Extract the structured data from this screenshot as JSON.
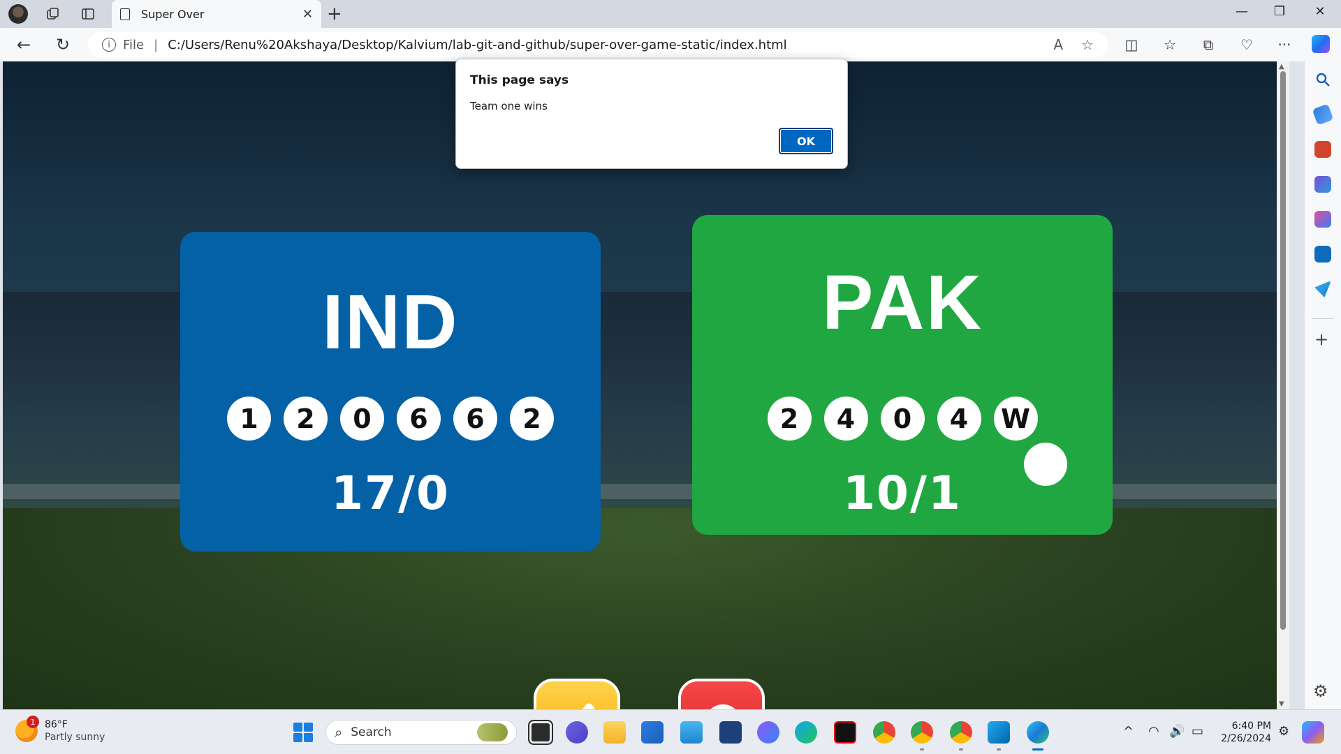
{
  "browser": {
    "tab_title": "Super Over",
    "tab_close": "✕",
    "new_tab": "+",
    "address_prefix": "File",
    "address_separator": "|",
    "url": "C:/Users/Renu%20Akshaya/Desktop/Kalvium/lab-git-and-github/super-over-game-static/index.html",
    "window_controls": {
      "minimize": "—",
      "restore": "❐",
      "close": "✕"
    },
    "nav": {
      "back": "←",
      "refresh": "↻"
    },
    "toolbar_icons": {
      "read_aloud": "A",
      "favorite": "☆",
      "split": "◫",
      "favorites": "☆",
      "collections": "⧉",
      "performance": "♡",
      "more": "···"
    }
  },
  "dialog": {
    "title": "This page says",
    "message": "Team one wins",
    "ok_label": "OK"
  },
  "game": {
    "team1": {
      "name": "IND",
      "balls": [
        "1",
        "2",
        "0",
        "6",
        "6",
        "2"
      ],
      "score": "17/0",
      "color": "#0561a6"
    },
    "team2": {
      "name": "PAK",
      "balls": [
        "2",
        "4",
        "0",
        "4",
        "W"
      ],
      "score": "10/1",
      "color": "#21a742"
    },
    "buttons": {
      "strike": "bat-icon",
      "reset": "reset-icon"
    }
  },
  "sidebar": {
    "icons": [
      "search-icon",
      "shopping-icon",
      "tools-icon",
      "games-icon",
      "microsoft365-icon",
      "outlook-icon",
      "drop-icon"
    ],
    "add": "+",
    "settings": "⚙"
  },
  "taskbar": {
    "weather": {
      "temp": "86°F",
      "condition": "Partly sunny",
      "badge": "1"
    },
    "search_placeholder": "Search",
    "clock": {
      "time": "6:40 PM",
      "date": "2/26/2024"
    },
    "tray": {
      "chevron": "^",
      "wifi": "◠",
      "volume": "🔊",
      "battery": "▭"
    }
  }
}
